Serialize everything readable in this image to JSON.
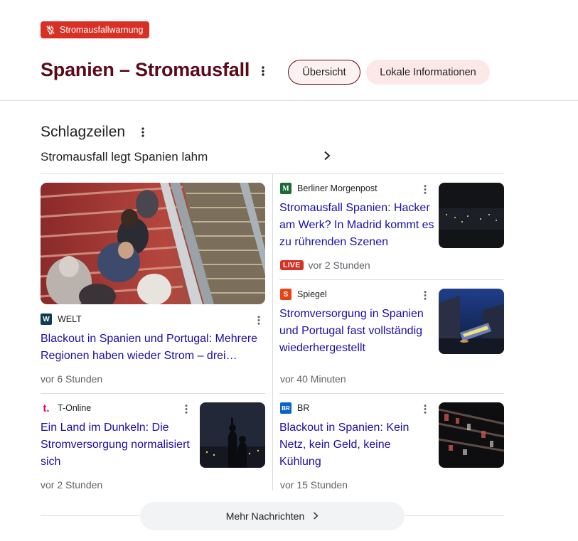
{
  "alert": {
    "label": "Stromausfallwarnung",
    "icon": "power-off-icon",
    "color": "#d93025"
  },
  "header": {
    "title": "Spanien – Stromausfall",
    "chips": [
      {
        "label": "Übersicht",
        "active": true
      },
      {
        "label": "Lokale Informationen",
        "active": false
      }
    ]
  },
  "headlines": {
    "section_title": "Schlagzeilen",
    "story_link": "Stromausfall legt Spanien lahm",
    "articles": [
      {
        "source": "WELT",
        "logo": "W",
        "logo_color": "#0d3c55",
        "title": "Blackout in Spanien und Portugal: Mehrere Regionen haben wieder Strom – drei AKWs…",
        "time": "vor 6 Stunden",
        "live": ""
      },
      {
        "source": "Berliner Morgenpost",
        "logo": "M",
        "logo_color": "#1a6b34",
        "title": "Stromausfall Spanien: Hacker am Werk? In Madrid kommt es zu rührenden Szenen",
        "time": "vor 2 Stunden",
        "live": "LIVE"
      },
      {
        "source": "Spiegel",
        "logo": "S",
        "logo_color": "#e64415",
        "title": "Stromversorgung in Spanien und Portugal fast vollständig wiederhergestellt",
        "time": "vor 40 Minuten",
        "live": ""
      },
      {
        "source": "T-Online",
        "logo": "t.",
        "logo_color": "#e20074",
        "title": "Ein Land im Dunkeln: Die Stromversorgung normalisiert sich",
        "time": "vor 2 Stunden",
        "live": ""
      },
      {
        "source": "BR",
        "logo": "BR",
        "logo_color": "#0a64c8",
        "title": "Blackout in Spanien: Kein Netz, kein Geld, keine Kühlung",
        "time": "vor 15 Stunden",
        "live": ""
      }
    ]
  },
  "more": {
    "label": "Mehr Nachrichten"
  }
}
